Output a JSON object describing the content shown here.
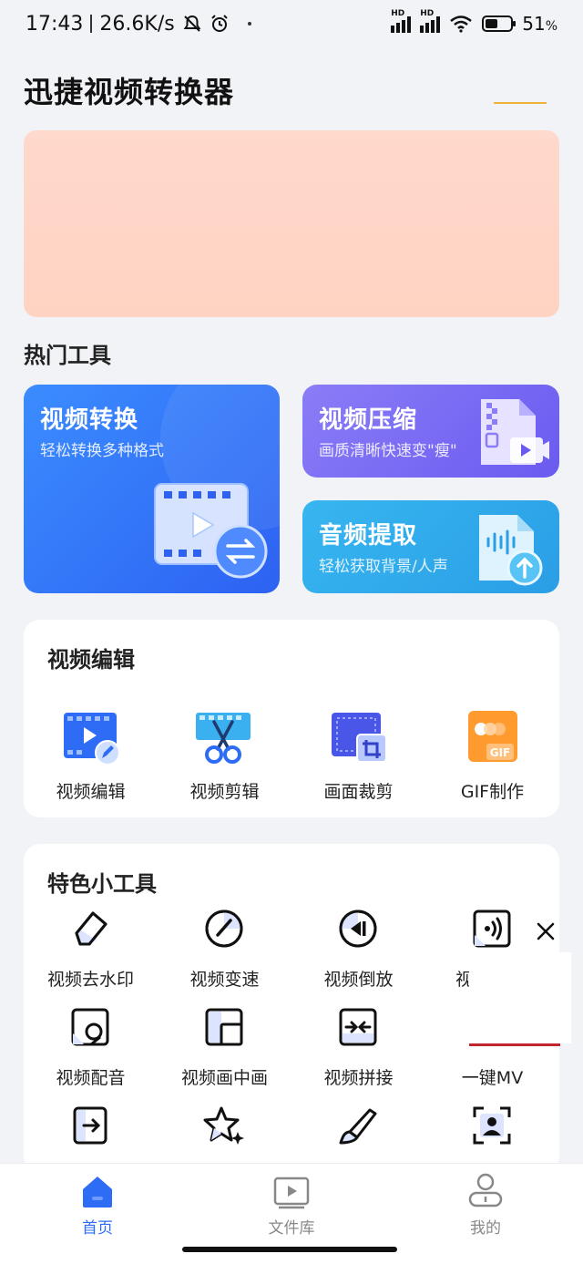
{
  "status_bar": {
    "time": "17:43",
    "speed": "26.6K/s",
    "battery": "51",
    "battery_unit": "%",
    "battery_level": 0.51,
    "icons": [
      "bell-off-icon",
      "alarm-icon",
      "signal-hd-icon",
      "signal-hd-icon",
      "wifi-icon",
      "battery-icon"
    ]
  },
  "header": {
    "title": "迅捷视频转换器"
  },
  "hot_tools": {
    "title": "热门工具",
    "cards": [
      {
        "title": "视频转换",
        "subtitle": "轻松转换多种格式"
      },
      {
        "title": "视频压缩",
        "subtitle": "画质清晰快速变\"瘦\""
      },
      {
        "title": "音频提取",
        "subtitle": "轻松获取背景/人声"
      }
    ]
  },
  "video_edit": {
    "title": "视频编辑",
    "items": [
      {
        "label": "视频编辑",
        "icon": "video-edit-icon"
      },
      {
        "label": "视频剪辑",
        "icon": "scissors-film-icon"
      },
      {
        "label": "画面裁剪",
        "icon": "crop-icon"
      },
      {
        "label": "GIF制作",
        "icon": "gif-icon"
      }
    ]
  },
  "feature_tools": {
    "title": "特色小工具",
    "items": [
      {
        "label": "视频去水印",
        "icon": "eraser-icon"
      },
      {
        "label": "视频变速",
        "icon": "speedometer-icon"
      },
      {
        "label": "视频倒放",
        "icon": "rewind-icon"
      },
      {
        "label": "视",
        "icon": "audio-wave-icon"
      },
      {
        "label": "视频配音",
        "icon": "microphone-icon"
      },
      {
        "label": "视频画中画",
        "icon": "picture-in-picture-icon"
      },
      {
        "label": "视频拼接",
        "icon": "merge-icon"
      },
      {
        "label": "一键MV",
        "icon": "mv-icon"
      },
      {
        "label": "",
        "icon": "export-icon"
      },
      {
        "label": "",
        "icon": "sparkle-star-icon"
      },
      {
        "label": "",
        "icon": "brush-icon"
      },
      {
        "label": "",
        "icon": "portrait-icon"
      }
    ]
  },
  "bottom_nav": {
    "items": [
      {
        "label": "首页",
        "icon": "home-icon",
        "active": true
      },
      {
        "label": "文件库",
        "icon": "folder-video-icon",
        "active": false
      },
      {
        "label": "我的",
        "icon": "user-icon",
        "active": false
      }
    ]
  },
  "colors": {
    "accent": "#2f6cf5",
    "convert_card": "#3b8cff",
    "compress_card": "#7d6ff4",
    "audio_card": "#32aceb",
    "banner": "#ffd6c6"
  }
}
